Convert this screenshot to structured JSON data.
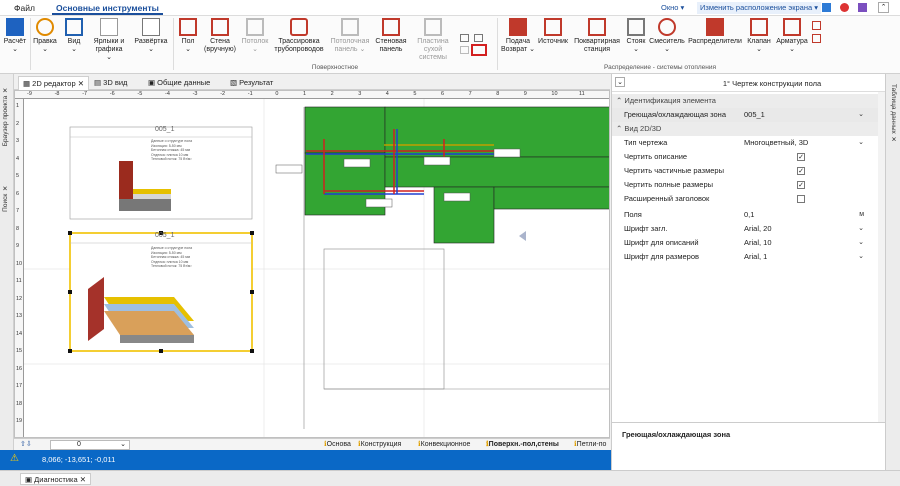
{
  "menu": {
    "file": "Файл",
    "main_tools": "Основные инструменты"
  },
  "topright": {
    "window": "Окно",
    "layout": "Изменить расположение экрана"
  },
  "ribbon": {
    "calc": "Расчёт",
    "edit": "Правка",
    "view": "Вид",
    "labels": "Ярлыки и графика",
    "unfold": "Развёртка",
    "floor": "Пол",
    "wall_manual": "Стена (вручную)",
    "ceiling": "Потолок",
    "trace_pipes": "Трассировка трубопроводов",
    "ceiling_panel": "Потолочная панель",
    "wall_panel": "Стеновая панель",
    "dry_plate": "Пластина сухой системы",
    "supply_return": "Подача Возврат",
    "source": "Источник",
    "apartment_station": "Поквартирная станция",
    "riser": "Стояк",
    "mixer": "Смеситель",
    "distributor": "Распределители",
    "valve": "Клапан",
    "armature": "Арматура",
    "group_surface": "Поверхностное",
    "group_distribution": "Распределение - системы отопления"
  },
  "left_strip": {
    "project_browser": "Браузер проекта",
    "search": "Поиск"
  },
  "doc_tabs": [
    "2D редактор",
    "3D вид",
    "Общие данные",
    "Результат"
  ],
  "canvas": {
    "ruler_h": [
      "-9",
      "-8",
      "-7",
      "-6",
      "-5",
      "-4",
      "-3",
      "-2",
      "-1",
      "0",
      "1",
      "2",
      "3",
      "4",
      "5",
      "6",
      "7",
      "8",
      "9",
      "10",
      "11"
    ],
    "ruler_v": [
      "1",
      "2",
      "3",
      "4",
      "5",
      "6",
      "7",
      "8",
      "9",
      "10",
      "11",
      "12",
      "13",
      "14",
      "15",
      "16",
      "17",
      "18",
      "19"
    ],
    "sheet1_title": "005_1",
    "sheet2_title": "005_1",
    "sheet1_text": [
      "Данные о структуре пола",
      "Изоляция: 5-50 мм",
      "Бетонная стяжка: 45 мм",
      "Отделка: плитка 10 мм",
      "Тепловой поток: 75 Вт/м²"
    ],
    "sheet2_text": [
      "Данные о структуре пола",
      "Изоляция: 5-50 мм",
      "Бетонная стяжка: 45 мм",
      "Отделка: плитка 10 мм",
      "Тепловой поток: 75 Вт/м²"
    ]
  },
  "layers": [
    "Основа",
    "Конструкция",
    "Конвекционное",
    "Поверхн.-пол,стены",
    "Петли-по"
  ],
  "layer_value": "0",
  "status": {
    "coords": "8,066; -13,651; -0,011"
  },
  "panel": {
    "title": "1° Чертеж конструкции пола",
    "sect_ident": "Идентификация элемента",
    "sect_view": "Вид 2D/3D",
    "rows": [
      {
        "k": "Греющая/охлаждающая зона",
        "v": "005_1"
      },
      {
        "k": "Тип чертежа",
        "v": "Многоцветный, 3D"
      },
      {
        "k": "Чертить описание",
        "v": "✓"
      },
      {
        "k": "Чертить частичные размеры",
        "v": "✓"
      },
      {
        "k": "Чертить полные размеры",
        "v": "✓"
      },
      {
        "k": "Расширенный заголовок",
        "v": ""
      },
      {
        "k": "Поля",
        "v": "0,1"
      },
      {
        "k": "Шрифт загл.",
        "v": "Arial, 20"
      },
      {
        "k": "Шрифт для описаний",
        "v": "Arial, 10"
      },
      {
        "k": "Шрифт для размеров",
        "v": "Arial, 1"
      }
    ],
    "unit": "м",
    "footer": "Греющая/охлаждающая зона"
  },
  "far_right": {
    "data_table": "Таблица данных"
  },
  "bottom": {
    "diagnostics": "Диагностика"
  },
  "colors": {
    "accent": "#1b4f9c",
    "status": "#0a68c6",
    "green": "#33a533"
  }
}
